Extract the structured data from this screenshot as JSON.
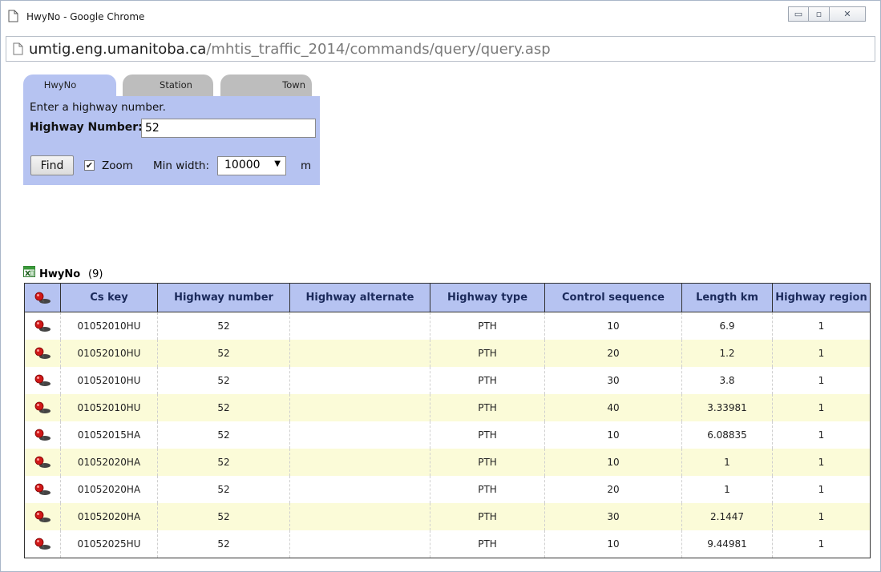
{
  "window": {
    "title": "HwyNo - Google Chrome",
    "controls": {
      "minimize": "▭",
      "maximize": "▫",
      "close": "✕"
    }
  },
  "address": {
    "host": "umtig.eng.umanitoba.ca",
    "path": "/mhtis_traffic_2014/commands/query/query.asp"
  },
  "query_panel": {
    "tabs": [
      {
        "label": "HwyNo",
        "active": true
      },
      {
        "label": "Station",
        "active": false
      },
      {
        "label": "Town",
        "active": false
      }
    ],
    "hint": "Enter a highway number.",
    "highway_number_label": "Highway Number:",
    "highway_number_value": "52",
    "find_button": "Find",
    "zoom_checked": true,
    "zoom_label": "Zoom",
    "min_width_label": "Min width:",
    "min_width_value": "10000",
    "min_width_unit": "m"
  },
  "results": {
    "name": "HwyNo",
    "count": "(9)",
    "columns": [
      "",
      "Cs key",
      "Highway number",
      "Highway alternate",
      "Highway type",
      "Control sequence",
      "Length km",
      "Highway region"
    ],
    "rows": [
      [
        "01052010HU",
        "52",
        "",
        "PTH",
        "10",
        "6.9",
        "1"
      ],
      [
        "01052010HU",
        "52",
        "",
        "PTH",
        "20",
        "1.2",
        "1"
      ],
      [
        "01052010HU",
        "52",
        "",
        "PTH",
        "30",
        "3.8",
        "1"
      ],
      [
        "01052010HU",
        "52",
        "",
        "PTH",
        "40",
        "3.33981",
        "1"
      ],
      [
        "01052015HA",
        "52",
        "",
        "PTH",
        "10",
        "6.08835",
        "1"
      ],
      [
        "01052020HA",
        "52",
        "",
        "PTH",
        "10",
        "1",
        "1"
      ],
      [
        "01052020HA",
        "52",
        "",
        "PTH",
        "20",
        "1",
        "1"
      ],
      [
        "01052020HA",
        "52",
        "",
        "PTH",
        "30",
        "2.1447",
        "1"
      ],
      [
        "01052025HU",
        "52",
        "",
        "PTH",
        "10",
        "9.44981",
        "1"
      ]
    ]
  },
  "colors": {
    "panel_blue": "#b6c3f1",
    "inactive_tab": "#bdbdbd",
    "alt_row": "#fbfbd8",
    "header_text": "#1b2a5b"
  }
}
